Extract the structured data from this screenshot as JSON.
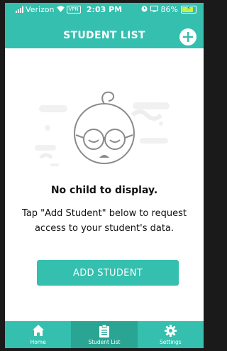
{
  "status_bar": {
    "carrier": "Verizon",
    "vpn": "VPN",
    "time": "2:03 PM",
    "battery_percent": "86%",
    "battery_level": 0.86
  },
  "header": {
    "title": "STUDENT LIST",
    "add_icon": "plus-circle-icon"
  },
  "empty_state": {
    "illustration_icon": "baby-face-icon",
    "title": "No child to display.",
    "description": "Tap \"Add Student\" below to request access to your student's data.",
    "button_label": "ADD STUDENT"
  },
  "tabs": [
    {
      "label": "Home",
      "icon": "home-icon",
      "active": false
    },
    {
      "label": "Student List",
      "icon": "clipboard-icon",
      "active": true
    },
    {
      "label": "Settings",
      "icon": "gear-icon",
      "active": false
    }
  ],
  "colors": {
    "accent": "#34bfae",
    "active_tab": "#2aa493"
  }
}
